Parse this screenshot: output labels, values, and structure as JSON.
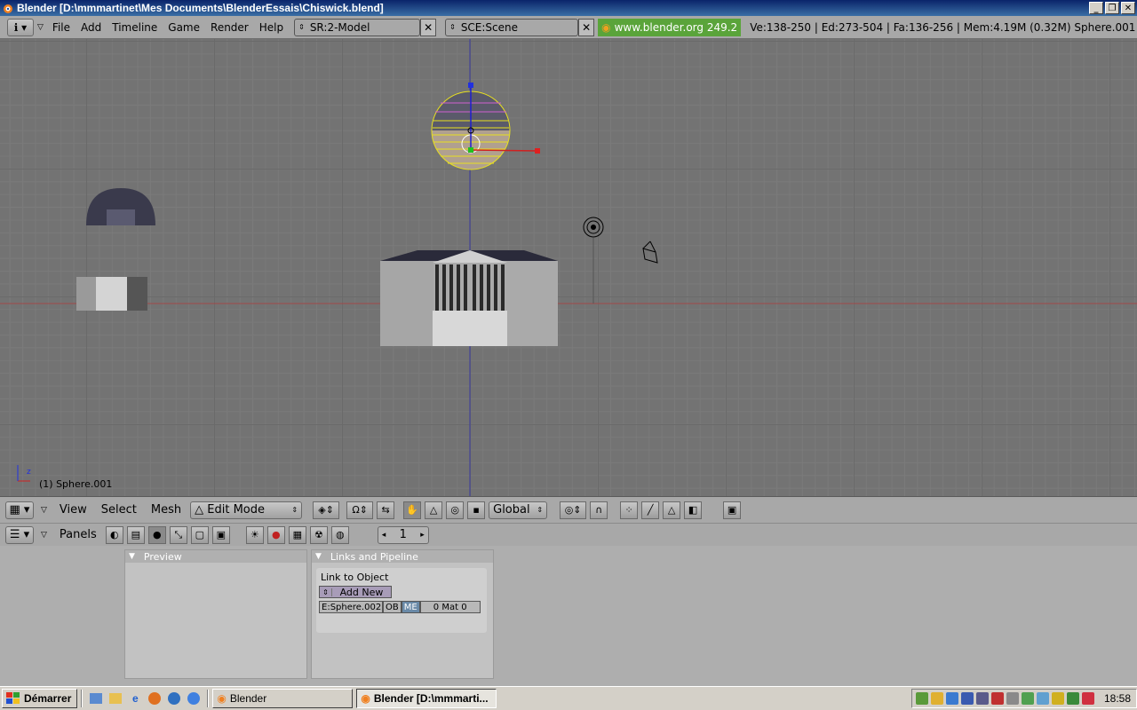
{
  "window": {
    "title": "Blender [D:\\mmmartinet\\Mes Documents\\BlenderEssais\\Chiswick.blend]",
    "controls": [
      "_",
      "❐",
      "✕"
    ]
  },
  "info_header": {
    "menus": [
      "File",
      "Add",
      "Timeline",
      "Game",
      "Render",
      "Help"
    ],
    "screen": "SR:2-Model",
    "scene": "SCE:Scene",
    "version": "www.blender.org 249.2",
    "stats": "Ve:138-250 | Ed:273-504 | Fa:136-256 | Mem:4.19M (0.32M) Sphere.001"
  },
  "viewport": {
    "object_label": "(1) Sphere.001"
  },
  "view3d_header": {
    "menus": [
      "View",
      "Select",
      "Mesh"
    ],
    "mode": "Edit Mode",
    "orientation": "Global"
  },
  "buttons_header": {
    "panels_label": "Panels",
    "frame": "1"
  },
  "panels": {
    "preview": {
      "title": "Preview"
    },
    "links": {
      "title": "Links and Pipeline",
      "link_to_object": "Link to Object",
      "add_new": "Add New",
      "mesh_name": "E:Sphere.002",
      "ob": "OB",
      "me": "ME",
      "mat": "0 Mat 0"
    }
  },
  "taskbar": {
    "start": "Démarrer",
    "tasks": [
      "Blender",
      "Blender [D:\\mmmarti..."
    ],
    "clock": "18:58"
  }
}
